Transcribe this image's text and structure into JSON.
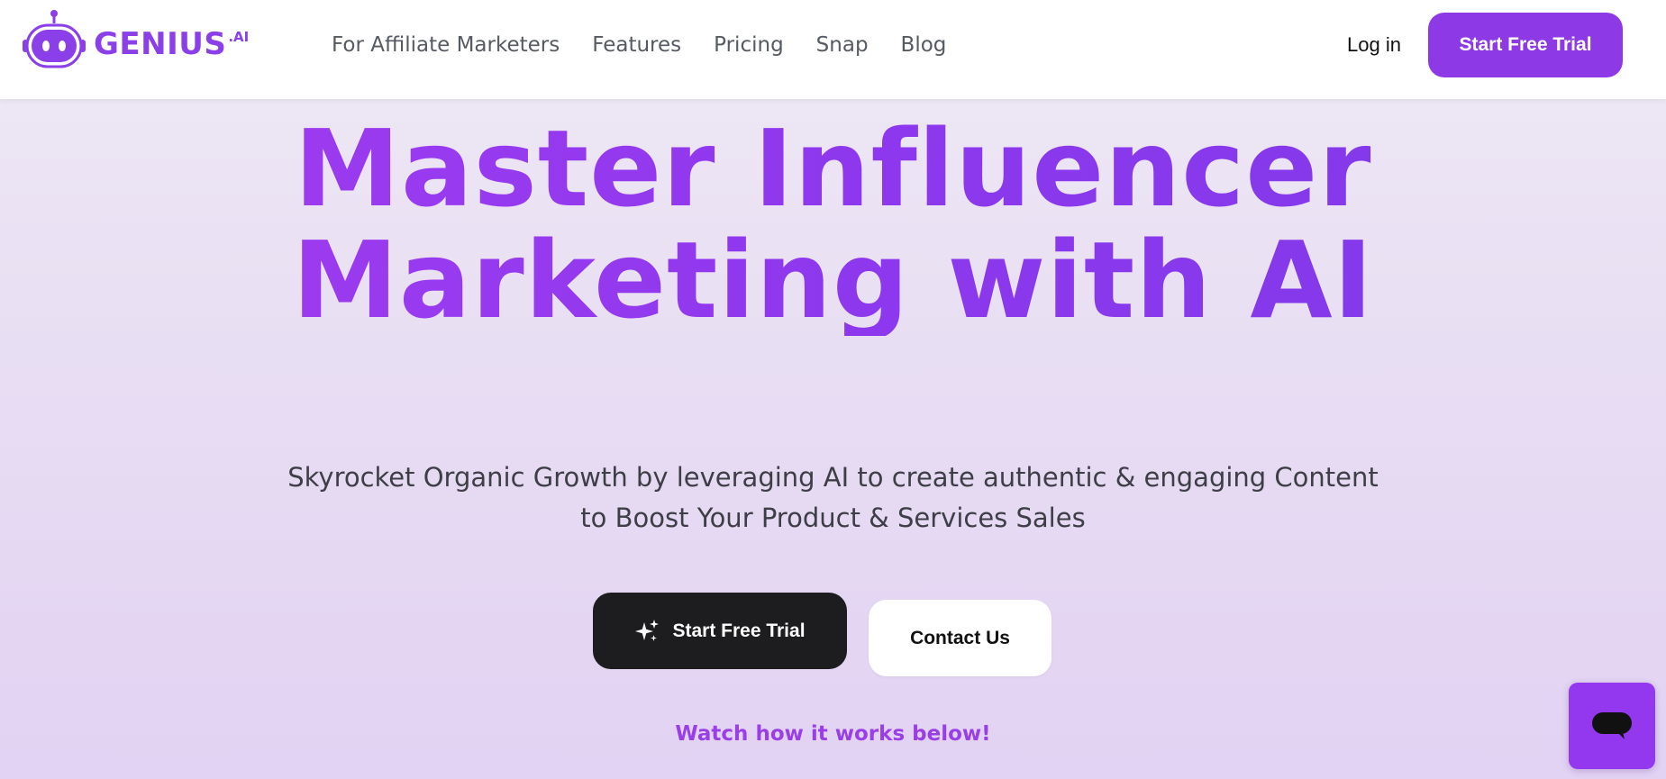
{
  "brand": {
    "name": "GENIUS",
    "suffix": ".AI",
    "color": "#8a3fe8"
  },
  "nav": {
    "items": [
      {
        "label": "For Affiliate Marketers"
      },
      {
        "label": "Features"
      },
      {
        "label": "Pricing"
      },
      {
        "label": "Snap"
      },
      {
        "label": "Blog"
      }
    ],
    "login_label": "Log in",
    "cta_label": "Start Free Trial"
  },
  "hero": {
    "title_line1": "Master Influencer",
    "title_line2": "Marketing with AI",
    "subtitle_line1": "Skyrocket Organic Growth by leveraging AI to create authentic & engaging Content",
    "subtitle_line2": "to Boost Your Product & Services Sales",
    "primary_button": "Start Free Trial",
    "primary_icon": "sparkle-icon",
    "secondary_button": "Contact Us",
    "watch_text": "Watch how it works below!"
  },
  "chat": {
    "icon": "chat-bubble-icon",
    "color": "#9438f0"
  },
  "colors": {
    "accent": "#8d3ae6",
    "dark_button": "#1d1d1f"
  }
}
